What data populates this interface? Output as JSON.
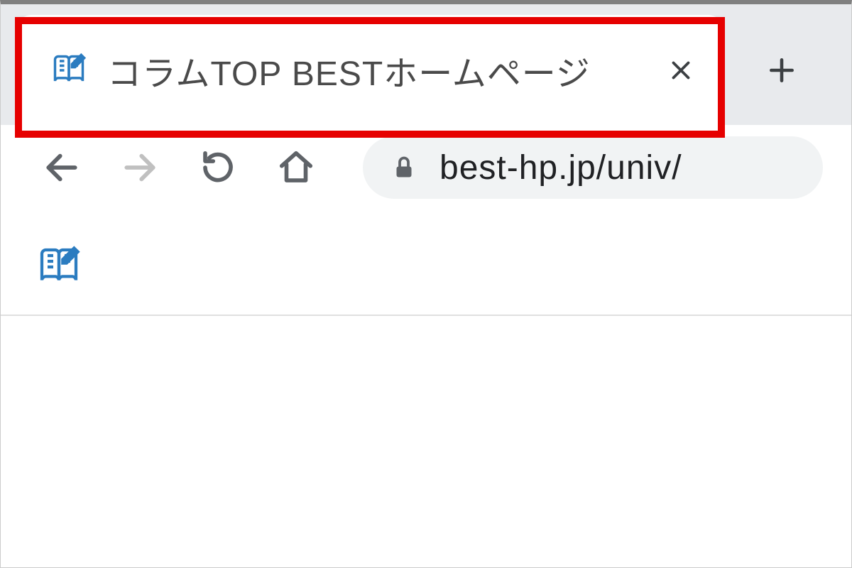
{
  "tab": {
    "title": "コラムTOP BESTホームページ",
    "favicon_name": "book-edit-icon"
  },
  "toolbar": {
    "back_enabled": true,
    "forward_enabled": false
  },
  "addressbar": {
    "secure": true,
    "url_display": "best-hp.jp/univ/"
  },
  "page": {
    "favicon_name": "book-edit-icon"
  },
  "colors": {
    "highlight": "#e60000",
    "favicon": "#2b7cc0",
    "tabstrip_bg": "#e8eaed",
    "addressbar_bg": "#f1f3f4"
  }
}
